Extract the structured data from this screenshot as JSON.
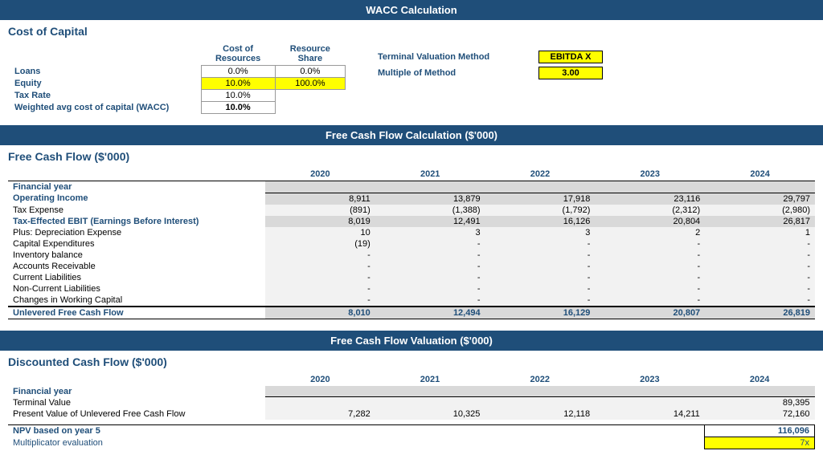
{
  "wacc_section": {
    "header": "WACC Calculation",
    "title": "Cost of Capital",
    "col_headers": [
      "Cost of Resources",
      "Resource Share"
    ],
    "rows": [
      {
        "label": "Loans",
        "cost": "0.0%",
        "share": "0.0%"
      },
      {
        "label": "Equity",
        "cost": "10.0%",
        "share": "100.0%"
      },
      {
        "label": "Tax Rate",
        "cost": "10.0%",
        "share": ""
      },
      {
        "label": "Weighted avg cost of capital (WACC)",
        "cost": "10.0%",
        "share": ""
      }
    ],
    "terminal_method_label": "Terminal Valuation Method",
    "terminal_method_value": "EBITDA X",
    "multiple_label": "Multiple of Method",
    "multiple_value": "3.00"
  },
  "fcf_section": {
    "header": "Free Cash Flow Calculation ($'000)",
    "title": "Free Cash Flow ($'000)",
    "col_headers": [
      "",
      "2020",
      "2021",
      "2022",
      "2023",
      "2024"
    ],
    "rows": [
      {
        "label": "Financial year",
        "indent": 0,
        "bold": true,
        "vals": [
          "",
          "",
          "",
          "",
          ""
        ],
        "is_header": true
      },
      {
        "label": "Operating Income",
        "indent": 0,
        "bold": true,
        "vals": [
          "8,911",
          "13,879",
          "17,918",
          "23,116",
          "29,797"
        ]
      },
      {
        "label": "Tax Expense",
        "indent": 1,
        "bold": false,
        "vals": [
          "(891)",
          "(1,388)",
          "(1,792)",
          "(2,312)",
          "(2,980)"
        ]
      },
      {
        "label": "Tax-Effected EBIT (Earnings Before Interest)",
        "indent": 0,
        "bold": true,
        "vals": [
          "8,019",
          "12,491",
          "16,126",
          "20,804",
          "26,817"
        ]
      },
      {
        "label": "Plus: Depreciation Expense",
        "indent": 1,
        "bold": false,
        "vals": [
          "10",
          "3",
          "3",
          "2",
          "1"
        ]
      },
      {
        "label": "Capital Expenditures",
        "indent": 1,
        "bold": false,
        "vals": [
          "(19)",
          "-",
          "-",
          "-",
          "-"
        ]
      },
      {
        "label": "Inventory balance",
        "indent": 3,
        "bold": false,
        "vals": [
          "-",
          "-",
          "-",
          "-",
          "-"
        ]
      },
      {
        "label": "Accounts Receivable",
        "indent": 3,
        "bold": false,
        "vals": [
          "-",
          "-",
          "-",
          "-",
          "-"
        ]
      },
      {
        "label": "Current Liabilities",
        "indent": 3,
        "bold": false,
        "vals": [
          "-",
          "-",
          "-",
          "-",
          "-"
        ]
      },
      {
        "label": "Non-Current Liabilities",
        "indent": 3,
        "bold": false,
        "vals": [
          "-",
          "-",
          "-",
          "-",
          "-"
        ]
      },
      {
        "label": "Changes in Working Capital",
        "indent": 1,
        "bold": false,
        "vals": [
          "-",
          "-",
          "-",
          "-",
          "-"
        ]
      },
      {
        "label": "Unlevered Free Cash Flow",
        "indent": 0,
        "bold": true,
        "vals": [
          "8,010",
          "12,494",
          "16,129",
          "20,807",
          "26,819"
        ],
        "final": true
      }
    ]
  },
  "valuation_section": {
    "header": "Free Cash Flow Valuation ($'000)",
    "title": "Discounted Cash Flow ($'000)",
    "col_headers": [
      "",
      "2020",
      "2021",
      "2022",
      "2023",
      "2024"
    ],
    "rows": [
      {
        "label": "Financial year",
        "indent": 0,
        "bold": true,
        "vals": [
          "",
          "",
          "",
          "",
          ""
        ],
        "is_header": true
      },
      {
        "label": "Terminal Value",
        "indent": 0,
        "bold": false,
        "vals": [
          "",
          "",
          "",
          "",
          "89,395"
        ]
      },
      {
        "label": "Present Value of Unlevered Free Cash Flow",
        "indent": 0,
        "bold": false,
        "vals": [
          "7,282",
          "10,325",
          "12,118",
          "14,211",
          "72,160"
        ]
      }
    ],
    "npv_label": "NPV based on year 5",
    "npv_value": "116,096",
    "mult_label": "Multiplicator evaluation",
    "mult_value": "7x"
  }
}
